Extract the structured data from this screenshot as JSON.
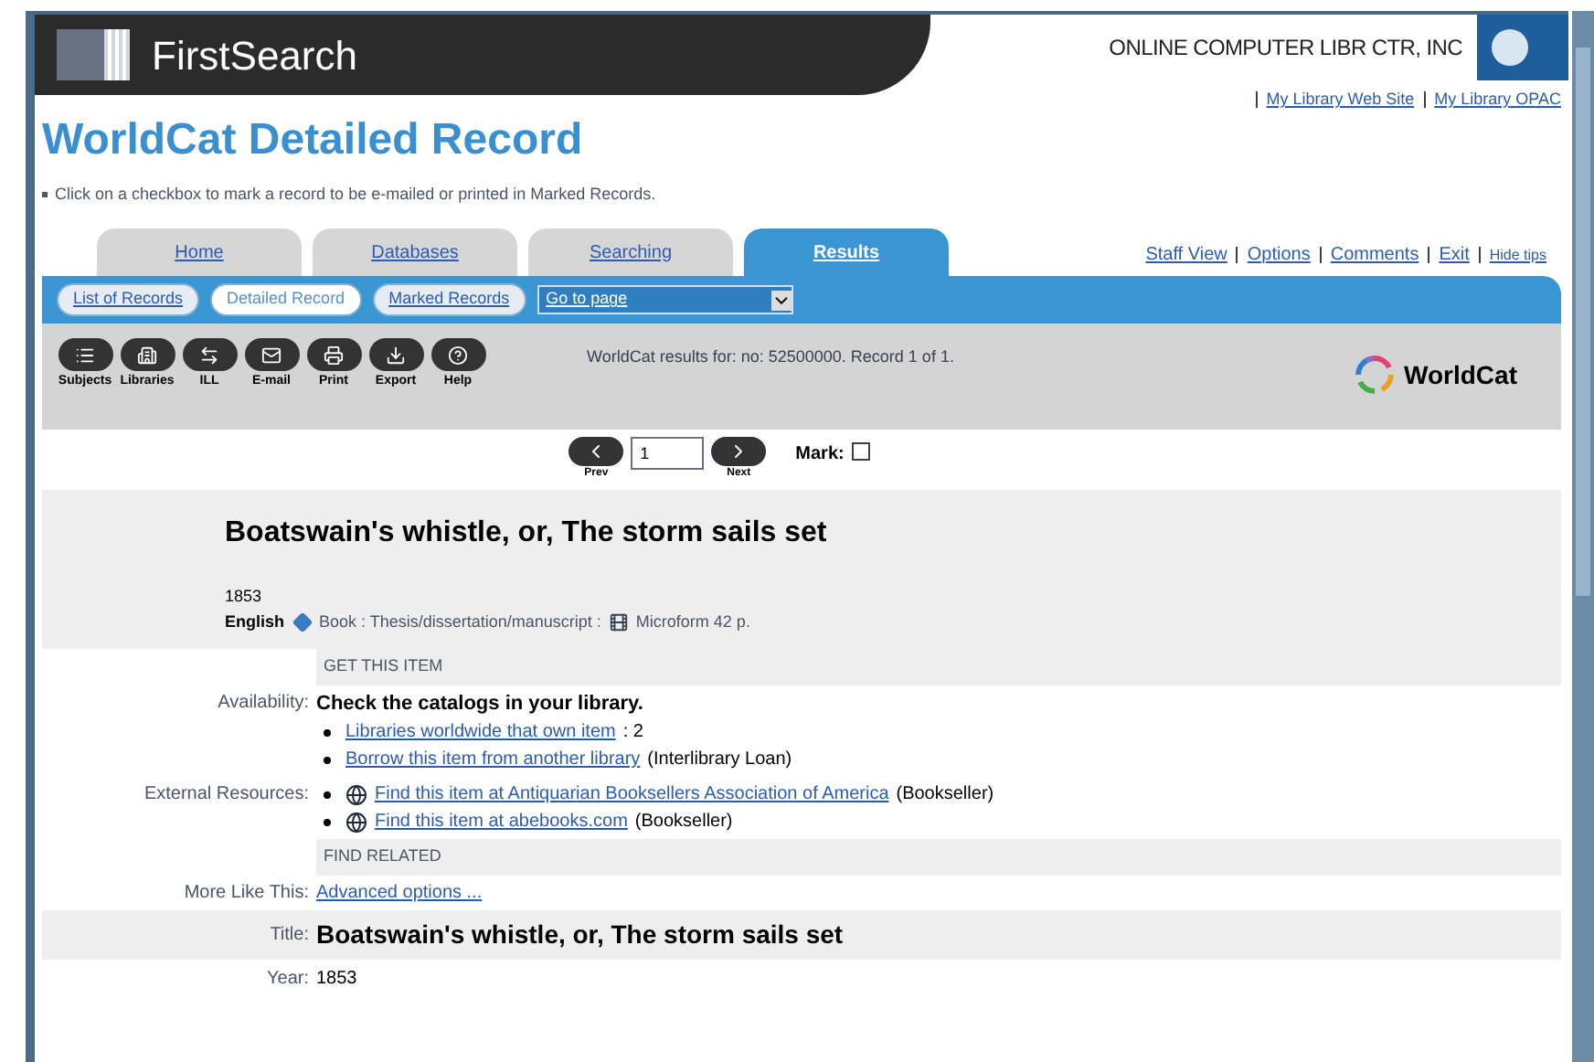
{
  "header": {
    "brand": "FirstSearch",
    "institution": "ONLINE COMPUTER LIBR CTR, INC",
    "links": [
      "My Library Web Site",
      "My Library OPAC"
    ]
  },
  "page_title": "WorldCat Detailed Record",
  "tip": "Click on a checkbox to mark a record to be e-mailed or printed in Marked Records.",
  "tabs": [
    {
      "label": "Home",
      "selected": false
    },
    {
      "label": "Databases",
      "selected": false
    },
    {
      "label": "Searching",
      "selected": false
    },
    {
      "label": "Results",
      "selected": true
    }
  ],
  "top_links": [
    "Staff View",
    "Options",
    "Comments",
    "Exit",
    "Hide tips"
  ],
  "subtabs": [
    {
      "label": "List of Records",
      "selected": false
    },
    {
      "label": "Detailed Record",
      "selected": true
    },
    {
      "label": "Marked Records",
      "selected": false
    }
  ],
  "go_to_page": {
    "value": "Go to page"
  },
  "toolbar": [
    {
      "kind": "subjects",
      "label": "Subjects"
    },
    {
      "kind": "libraries",
      "label": "Libraries"
    },
    {
      "kind": "ill",
      "label": "ILL"
    },
    {
      "kind": "email",
      "label": "E-mail"
    },
    {
      "kind": "print",
      "label": "Print"
    },
    {
      "kind": "export",
      "label": "Export"
    },
    {
      "kind": "help",
      "label": "Help"
    }
  ],
  "results_info": "WorldCat results for: no: 52500000. Record 1 of 1.",
  "logo": "WorldCat",
  "navigation": {
    "prev": "Prev",
    "next": "Next",
    "record": "1",
    "mark_label": "Mark:",
    "mark_checked": false
  },
  "record": {
    "title": "Boatswain's whistle, or, The storm sails set",
    "year": "1853",
    "language": "English",
    "format": "Book : Thesis/dissertation/manuscript :",
    "microform": "Microform 42 p."
  },
  "sections": [
    {
      "kind": "header",
      "text": "GET THIS ITEM"
    },
    {
      "kind": "row",
      "label": "Availability:",
      "bold": "Check the catalogs in your library.",
      "items": [
        {
          "link": "Libraries worldwide that own item",
          "after": ": 2",
          "globe": false
        },
        {
          "link": "Borrow this item from another library",
          "after": "(Interlibrary Loan)",
          "globe": false
        }
      ]
    },
    {
      "kind": "row",
      "label": "External Resources:",
      "items": [
        {
          "link": "Find this item at Antiquarian Booksellers Association of America",
          "after": "(Bookseller)",
          "globe": true
        },
        {
          "link": "Find this item at abebooks.com",
          "after": "(Bookseller)",
          "globe": true
        }
      ]
    },
    {
      "kind": "header",
      "text": "FIND RELATED"
    },
    {
      "kind": "row",
      "label": "More Like This:",
      "items": [
        {
          "link": "Advanced options ...",
          "globe": false
        }
      ],
      "plain": true
    },
    {
      "kind": "title",
      "label": "Title:",
      "value": "Boatswain's whistle, or, The storm sails set"
    },
    {
      "kind": "value",
      "label": "Year:",
      "value": "1853"
    }
  ]
}
